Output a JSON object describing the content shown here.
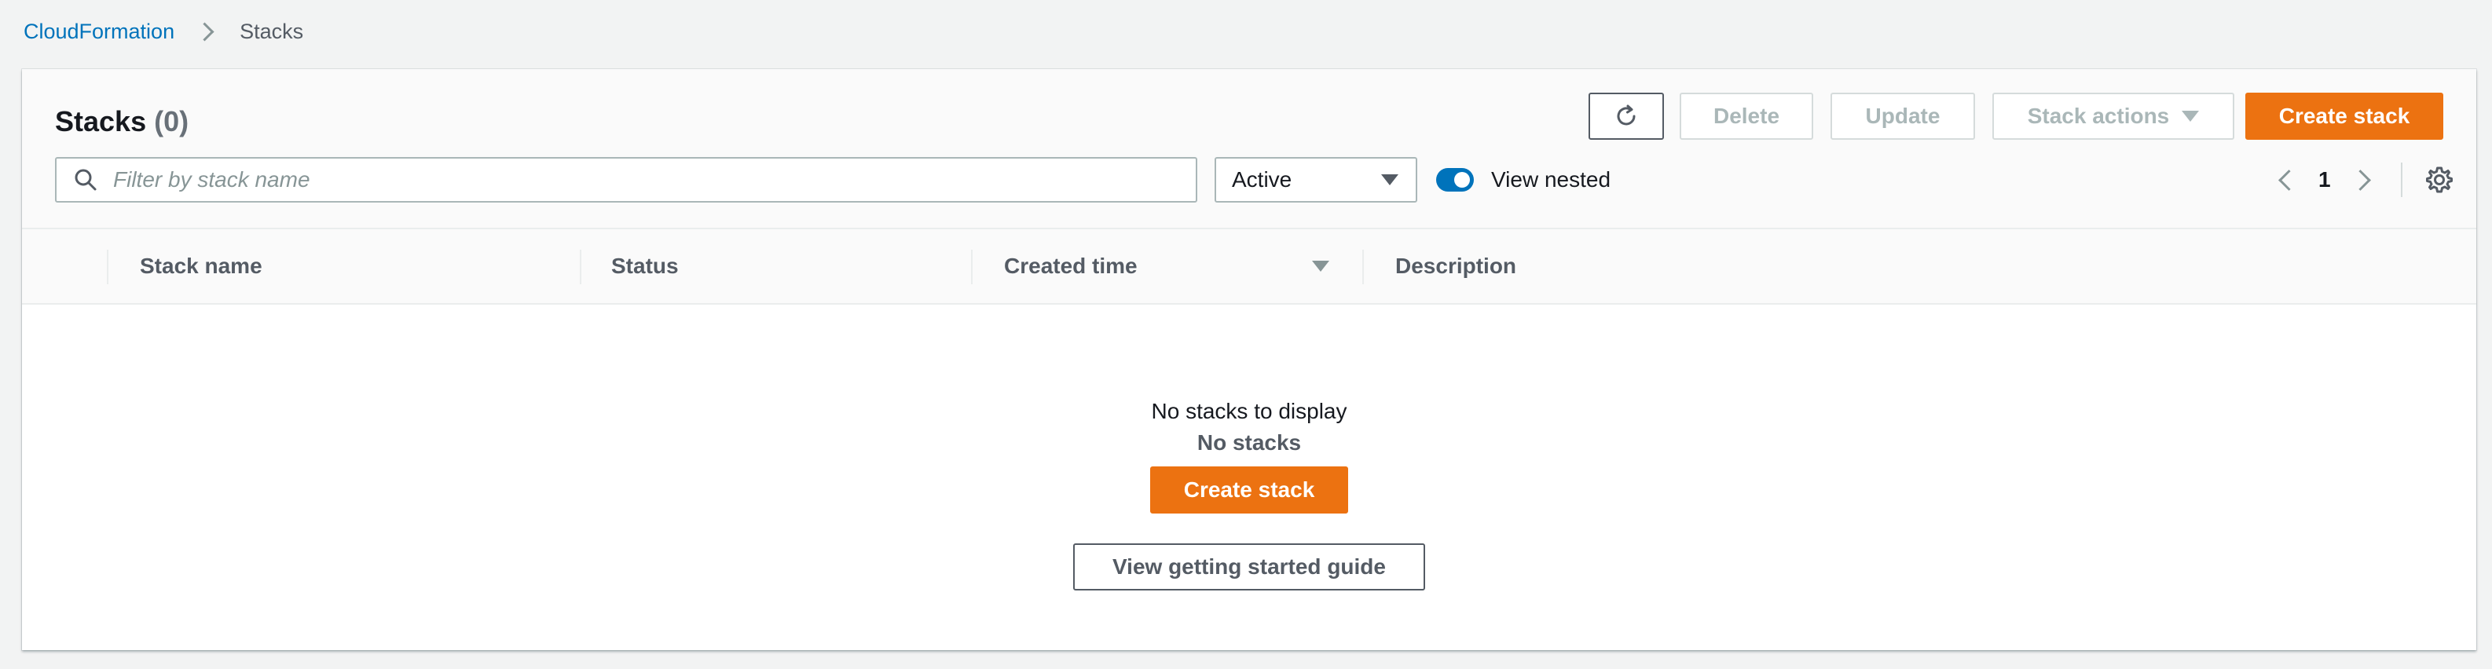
{
  "breadcrumb": {
    "root": "CloudFormation",
    "current": "Stacks"
  },
  "header": {
    "title": "Stacks",
    "count": "(0)"
  },
  "toolbar": {
    "delete_label": "Delete",
    "update_label": "Update",
    "stack_actions_label": "Stack actions",
    "create_stack_label": "Create stack"
  },
  "filter": {
    "placeholder": "Filter by stack name",
    "status_selected": "Active",
    "view_nested_label": "View nested",
    "view_nested_on": true
  },
  "pagination": {
    "current_page": "1"
  },
  "table": {
    "columns": [
      "Stack name",
      "Status",
      "Created time",
      "Description"
    ]
  },
  "empty_state": {
    "title": "No stacks",
    "subtitle": "No stacks to display",
    "create_label": "Create stack",
    "guide_label": "View getting started guide"
  },
  "colors": {
    "accent": "#ec7211",
    "link": "#0073bb",
    "toggle_on": "#0073bb"
  }
}
